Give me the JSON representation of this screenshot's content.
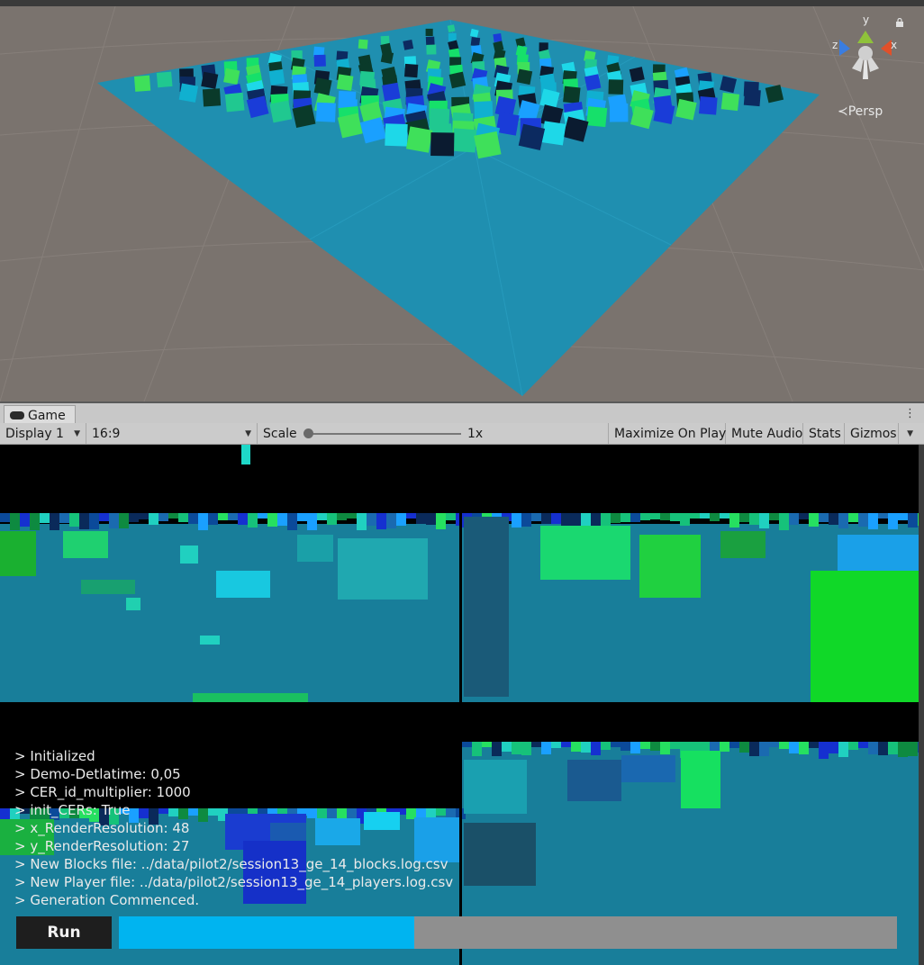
{
  "scene": {
    "persp_label": "Persp",
    "gizmo_axes": {
      "y": "y",
      "x": "x",
      "z": "z"
    },
    "icons": [
      "lock-icon",
      "orientation-gizmo-icon"
    ]
  },
  "game_tab": {
    "label": "Game",
    "icon": "gamepad-icon",
    "menu_glyph": "⋮"
  },
  "toolbar": {
    "display": "Display 1",
    "aspect": "16:9",
    "scale_label": "Scale",
    "scale_value": "1x",
    "maximize_on_play": "Maximize On Play",
    "mute_audio": "Mute Audio",
    "stats": "Stats",
    "gizmos": "Gizmos"
  },
  "console": {
    "lines": [
      "> Initialized",
      "> Demo-Detlatime: 0,05",
      "> CER_id_multiplier: 1000",
      "> init_CERs: True",
      "> x_RenderResolution: 48",
      "> y_RenderResolution: 27",
      "> New Blocks file: ../data/pilot2/session13_ge_14_blocks.log.csv",
      "> New Player file: ../data/pilot2/session13_ge_14_players.log.csv",
      "> Generation Commenced."
    ]
  },
  "controls": {
    "run_label": "Run",
    "progress": 0.38
  },
  "colors": {
    "scene_bg": "#7a736e",
    "floor": "#1f8fb0",
    "game_water": "#187e9a",
    "progress_fill": "#00b4f0",
    "progress_track": "#8f8f8f"
  }
}
